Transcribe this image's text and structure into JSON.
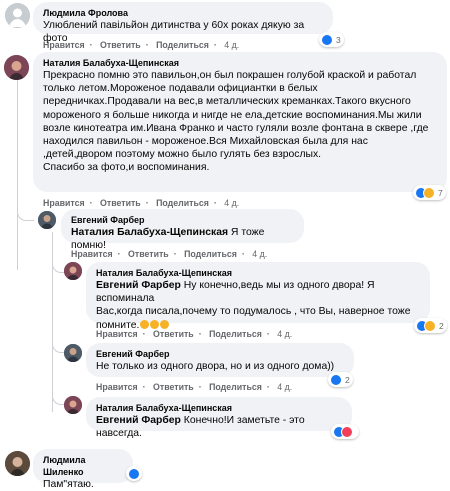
{
  "actions": {
    "like": "Нравится",
    "reply": "Ответить",
    "share": "Поделиться",
    "age": "4 д."
  },
  "comments": [
    {
      "author": "Людмила Фролова",
      "text": "Улюблений павільйон дитинства у 60х роках дякую за фото",
      "reactions": {
        "types": [
          "like"
        ],
        "count": "3"
      }
    },
    {
      "author": "Наталия Балабуха-Щепинская",
      "lines": [
        "Прекрасно помню это павильон,он был покрашен голубой краской и работал",
        "только летом.Мороженое подавали официантки в белых",
        "передничках.Продавали на вес,в металлических креманках.Такого вкусного",
        "мороженого я больше никогда и нигде не ела,детские воспоминания.Мы жили",
        "возле кинотеатра им.Ивана Франко и часто гуляли возле фонтана в сквере ,где",
        "находился павильон - мороженое.Вся Михайловская была для нас",
        ",детей,двором поэтому можно было гулять без взрослых.",
        "Спасибо за фото,и воспоминания."
      ],
      "reactions": {
        "types": [
          "like",
          "care"
        ],
        "count": "7"
      }
    },
    {
      "author": "Евгений Фарбер",
      "mention": "Наталия Балабуха-Щепинская",
      "text": " Я тоже помню!"
    },
    {
      "author": "Наталия Балабуха-Щепинская",
      "mention": "Евгений Фарбер",
      "line1": " Ну конечно,ведь мы из одного двора! Я вспоминала",
      "line2": "Вас,когда писала,почему то подумалось , что Вы, наверное тоже",
      "line3": "помните.",
      "reactions": {
        "types": [
          "like",
          "care"
        ],
        "count": "2"
      }
    },
    {
      "author": "Евгений Фарбер",
      "text": "Не только из одного двора, но и из одного дома))",
      "reactions": {
        "types": [
          "like"
        ],
        "count": "2"
      }
    },
    {
      "author": "Наталия Балабуха-Щепинская",
      "mention": "Евгений Фарбер",
      "text": " Конечно!И заметьте - это навсегда.",
      "reactions": {
        "types": [
          "like",
          "love"
        ],
        "count": ""
      }
    },
    {
      "author": "Людмила Шиленко",
      "text": "Пам\"ятаю.",
      "reactions": {
        "types": [
          "like"
        ],
        "count": ""
      }
    }
  ],
  "colors": {
    "like": "#1877f2",
    "love": "#f33e58",
    "care": "#f7b125",
    "bubble": "#f0f2f5"
  }
}
